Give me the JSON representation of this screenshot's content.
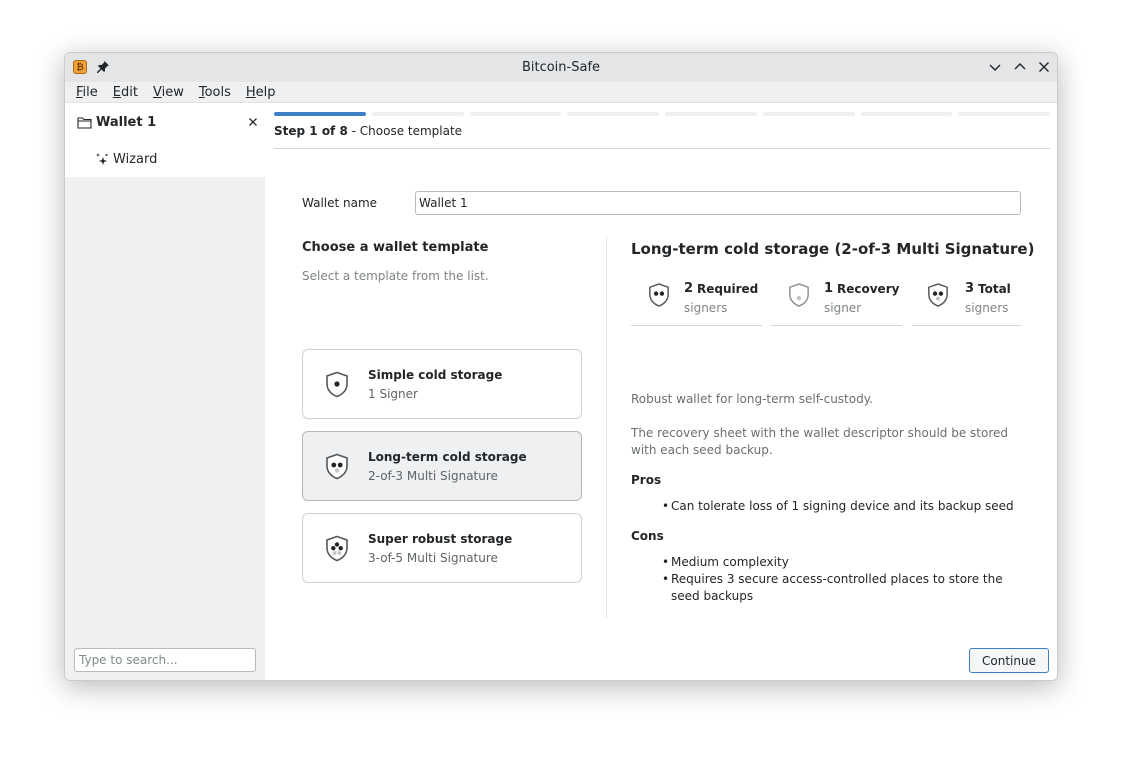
{
  "window": {
    "title": "Bitcoin-Safe"
  },
  "menu": [
    "File",
    "Edit",
    "View",
    "Tools",
    "Help"
  ],
  "sidebar": {
    "wallet_tab": "Wallet 1",
    "wizard_item": "Wizard",
    "search_placeholder": "Type to search..."
  },
  "wizard": {
    "total_steps": 8,
    "current_step": 1,
    "step_bold": "Step 1 of 8",
    "step_text": " - Choose template"
  },
  "form": {
    "wallet_name_label": "Wallet name",
    "wallet_name_value": "Wallet 1"
  },
  "templates": {
    "title": "Choose a wallet template",
    "subtitle": "Select a template from the list.",
    "items": [
      {
        "name": "Simple cold storage",
        "desc": "1 Signer",
        "icon": "shield-single-dot-icon"
      },
      {
        "name": "Long-term cold storage",
        "desc": "2-of-3 Multi Signature",
        "icon": "shield-two-dots-icon"
      },
      {
        "name": "Super robust storage",
        "desc": "3-of-5 Multi Signature",
        "icon": "shield-three-dots-icon"
      }
    ],
    "selected_index": 1
  },
  "detail": {
    "title": "Long-term cold storage (2-of-3 Multi Signature)",
    "stats": [
      {
        "num": "2",
        "label": "Required",
        "sub": "signers",
        "icon": "shield-two-dots-icon"
      },
      {
        "num": "1",
        "label": "Recovery",
        "sub": "signer",
        "icon": "shield-recovery-icon"
      },
      {
        "num": "3",
        "label": "Total",
        "sub": "signers",
        "icon": "shield-three-dots-icon"
      }
    ],
    "description": "Robust wallet for long-term self-custody.",
    "recovery_note": "The recovery sheet with the wallet descriptor should be stored with each seed backup.",
    "pros_label": "Pros",
    "pros": [
      "Can tolerate loss of 1 signing device and its backup seed"
    ],
    "cons_label": "Cons",
    "cons": [
      "Medium complexity",
      "Requires 3 secure access-controlled places to store the seed backups"
    ]
  },
  "actions": {
    "continue": "Continue"
  },
  "colors": {
    "accent": "#3d7fc7",
    "window_bg": "#eff0f1",
    "selected_card": "#eff0f1"
  }
}
